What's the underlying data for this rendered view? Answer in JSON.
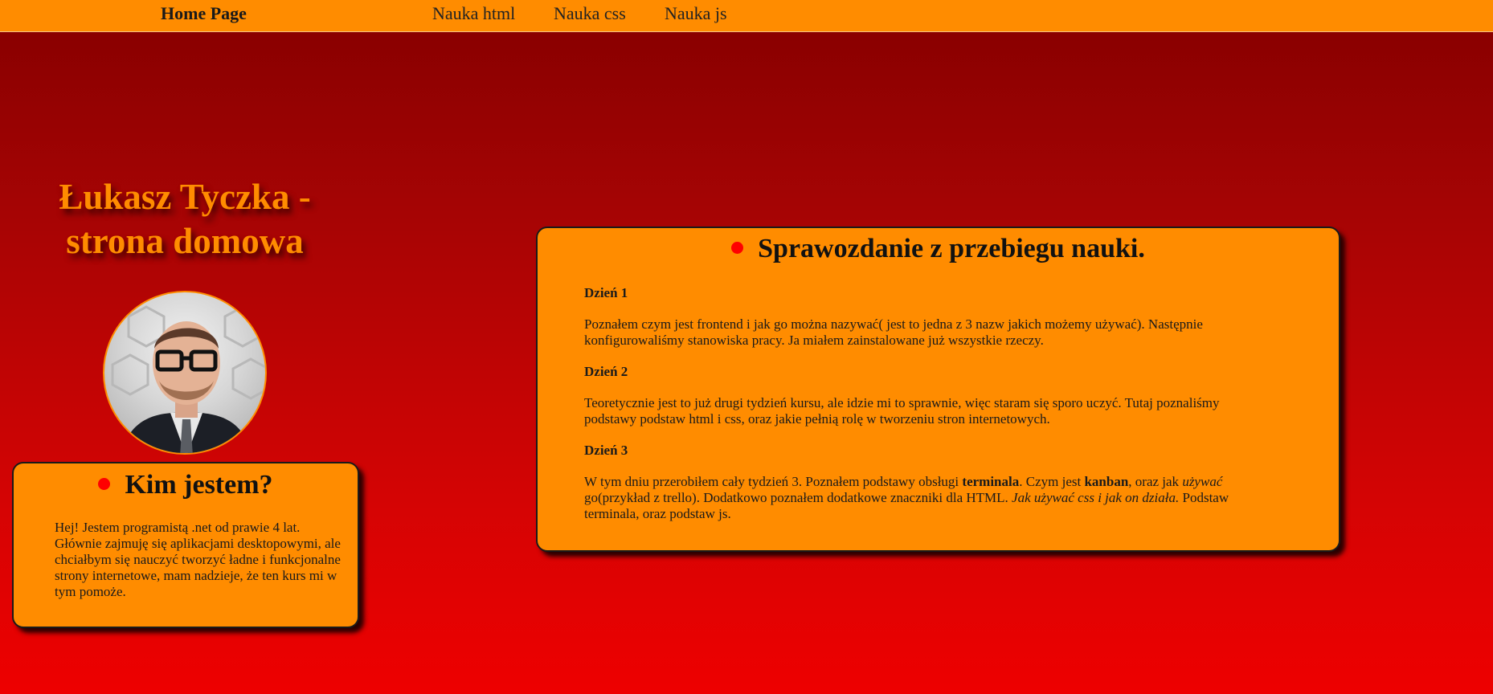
{
  "nav": {
    "home": "Home Page",
    "links": [
      "Nauka html",
      "Nauka css",
      "Nauka js"
    ]
  },
  "title": "Łukasz Tyczka - strona domowa",
  "about": {
    "heading": "Kim jestem?",
    "text": "Hej! Jestem programistą .net od prawie 4 lat. Głównie zajmuję się aplikacjami desktopowymi, ale chciałbym się nauczyć tworzyć ładne i funkcjonalne strony internetowe, mam nadzieje, że ten kurs mi w tym pomoże."
  },
  "report": {
    "heading": "Sprawozdanie z przebiegu nauki.",
    "days": [
      {
        "title": "Dzień 1",
        "text": "Poznałem czym jest frontend i jak go można nazywać( jest to jedna z 3 nazw jakich możemy używać). Następnie konfigurowaliśmy stanowiska pracy. Ja miałem zainstalowane już wszystkie rzeczy."
      },
      {
        "title": "Dzień 2",
        "text": "Teoretycznie jest to już drugi tydzień kursu, ale idzie mi to sprawnie, więc staram się sporo uczyć. Tutaj poznaliśmy podstawy podstaw html i css, oraz jakie pełnią rolę w tworzeniu stron internetowych."
      },
      {
        "title": "Dzień 3",
        "text_parts": [
          "W tym dniu przerobiłem cały tydzień 3. Poznałem podstawy obsługi ",
          "terminala",
          ". Czym jest ",
          "kanban",
          ", oraz jak ",
          "używać",
          " go(przykład z trello). Dodatkowo poznałem dodatkowe znaczniki dla HTML. ",
          "Jak używać css i jak on działa.",
          " Podstaw terminala, oraz podstaw js."
        ]
      }
    ]
  },
  "colors": {
    "nav_background": "#ff8c00",
    "card_background": "#ff8c00",
    "title_color": "#ff8c00",
    "bullet": "#ff0000",
    "background_top": "#8a0000",
    "background_bottom": "#ee0000"
  }
}
